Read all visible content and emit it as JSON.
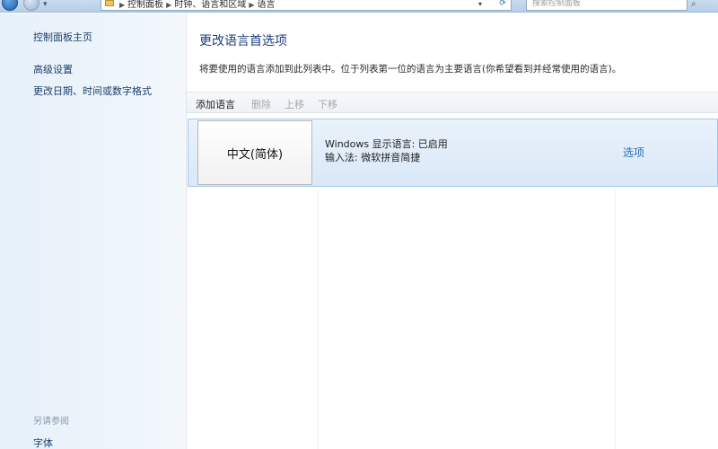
{
  "address_bar": {
    "crumbs": [
      "控制面板",
      "时钟、语言和区域",
      "语言"
    ],
    "search_placeholder": "搜索控制面板"
  },
  "sidebar": {
    "home": "控制面板主页",
    "advanced": "高级设置",
    "date_format": "更改日期、时间或数字格式",
    "see_also": "另请参阅",
    "fonts": "字体"
  },
  "main": {
    "title": "更改语言首选项",
    "description": "将要使用的语言添加到此列表中。位于列表第一位的语言为主要语言(你希望看到并经常使用的语言)。"
  },
  "toolbar": {
    "add": "添加语言",
    "remove": "删除",
    "move_up": "上移",
    "move_down": "下移"
  },
  "language_list": [
    {
      "name": "中文(简体)",
      "display_status": "Windows 显示语言: 已启用",
      "input_method": "输入法: 微软拼音简捷",
      "options": "选项"
    }
  ],
  "icons": {
    "back": "back-arrow-icon",
    "forward": "forward-arrow-icon",
    "refresh": "refresh-icon",
    "search": "search-icon",
    "folder": "control-panel-icon"
  }
}
